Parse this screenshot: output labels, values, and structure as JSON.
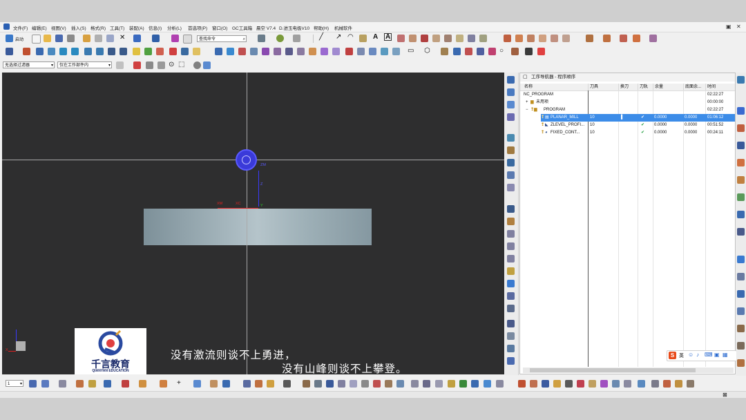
{
  "app": {
    "menus": [
      "文件(F)",
      "编辑(E)",
      "视图(V)",
      "插入(S)",
      "格式(R)",
      "工具(T)",
      "装配(A)",
      "信息(I)",
      "分析(L)",
      "首选项(P)",
      "窗口(O)",
      "GC工具箱",
      "晨空 V7.4",
      "D.进玉电极V10",
      "帮助(H)",
      "机械软件"
    ]
  },
  "toolbar": {
    "start_label": "启动",
    "command_search": "查找命令",
    "selection_filter": "无选择过滤器",
    "scope": "仅在工作部件内",
    "layer_value": "1"
  },
  "viewport": {
    "axis_zm": "ZM",
    "axis_z": "Z",
    "axis_xm": "XM",
    "axis_xc": "XC",
    "axis_y": "Y",
    "triad_x": "X"
  },
  "branding": {
    "logo_cn": "千言教育",
    "logo_en": "QIANYAN EDUCATION"
  },
  "subtitle": {
    "line1": "没有激流则谈不上勇进，",
    "line2": "没有山峰则谈不上攀登。"
  },
  "navigator": {
    "title": "工序导航器 - 程序顺序",
    "columns": [
      "名称",
      "刀具",
      "换刀",
      "刀轨",
      "余量",
      "底面余...",
      "时间"
    ],
    "rows": [
      {
        "name": "NC_PROGRAM",
        "tool": "",
        "change": "",
        "path": "",
        "stock": "",
        "floor": "",
        "time": "02:22:27"
      },
      {
        "name": "未用项",
        "tool": "",
        "change": "",
        "path": "",
        "stock": "",
        "floor": "",
        "time": "00:00:00"
      },
      {
        "name": "PROGRAM",
        "tool": "",
        "change": "",
        "path": "",
        "stock": "",
        "floor": "",
        "time": "02:22:27"
      },
      {
        "name": "PLANAR_MILL",
        "tool": "10",
        "change": "",
        "path": "✔",
        "stock": "0.0000",
        "floor": "0.0000",
        "time": "01:06:12"
      },
      {
        "name": "ZLEVEL_PROFI...",
        "tool": "10",
        "change": "",
        "path": "✔",
        "stock": "0.0000",
        "floor": "0.0000",
        "time": "00:51:52"
      },
      {
        "name": "FIXED_CONT...",
        "tool": "10",
        "change": "",
        "path": "✔",
        "stock": "0.0000",
        "floor": "0.0000",
        "time": "00:24:11"
      }
    ]
  },
  "ime": {
    "label": "英"
  },
  "colors": {
    "accent": "#3c8ce8",
    "viewport_bg": "#2e2e2f",
    "tool": "#3a3ad9",
    "check": "#1a9a3a"
  }
}
